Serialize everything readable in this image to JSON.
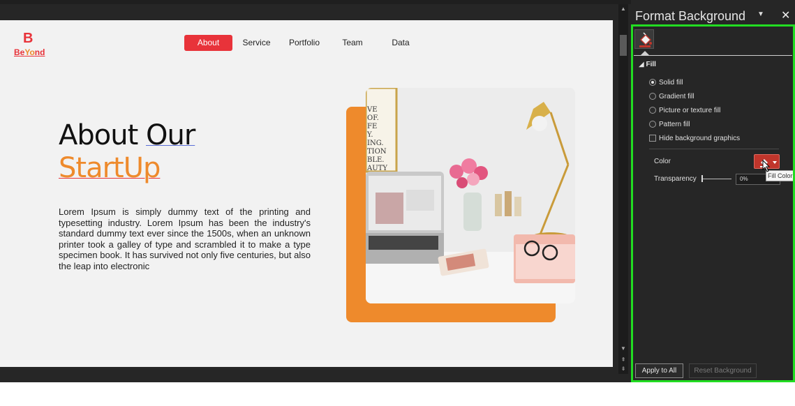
{
  "slide": {
    "logo_mark": "B",
    "logo_text_a": "Be",
    "logo_text_b": "Yo",
    "logo_text_c": "nd",
    "nav": [
      "About",
      "Service",
      "Portfolio",
      "Team",
      "Data"
    ],
    "heading_line1_a": "About ",
    "heading_line1_b": "Our",
    "heading_line2": "StartUp",
    "body": "Lorem Ipsum is simply dummy text of the printing and typesetting industry. Lorem Ipsum has been the industry's standard dummy text ever since the 1500s, when an unknown printer took a galley of type and scrambled it to make a type specimen book. It has survived not only five centuries, but also the leap into electronic",
    "photo_text": [
      "VE",
      "OF.",
      "FE",
      "Y.",
      "ING.",
      "TION",
      "BLE.",
      "AUTY"
    ]
  },
  "pane": {
    "title": "Format Background",
    "section": "Fill",
    "options": {
      "solid": "Solid fill",
      "gradient": "Gradient fill",
      "picture": "Picture or texture fill",
      "pattern": "Pattern fill",
      "hide": "Hide background graphics"
    },
    "selected_fill": "Solid fill",
    "color_label": "Color",
    "transparency_label": "Transparency",
    "transparency_value": "0%",
    "tooltip": "Fill Color",
    "apply_all": "Apply to All",
    "reset": "Reset Background"
  },
  "colors": {
    "accent_red": "#e8333a",
    "accent_orange": "#ee8a2c",
    "highlight": "#22dd22",
    "fill_color": "#c0352b"
  },
  "icons": [
    "paint-bucket-icon",
    "close-icon",
    "dropdown-caret-icon",
    "cursor-icon"
  ]
}
